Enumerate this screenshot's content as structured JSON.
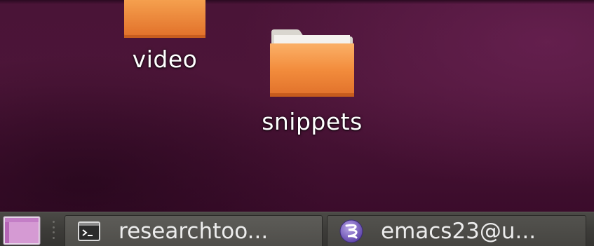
{
  "desktop": {
    "icons": [
      {
        "label": "video",
        "icon": "folder-icon"
      },
      {
        "label": "snippets",
        "icon": "folder-icon"
      }
    ]
  },
  "panel": {
    "show_desktop_icon": "show-desktop-icon",
    "tasks": [
      {
        "label": "researchtoo...",
        "icon": "terminal-icon"
      },
      {
        "label": "emacs23@u...",
        "icon": "emacs-icon"
      }
    ]
  },
  "colors": {
    "wallpaper": "#4a1437",
    "folder": "#f0893a",
    "panel": "#3d3c39",
    "text": "#ffffff"
  }
}
